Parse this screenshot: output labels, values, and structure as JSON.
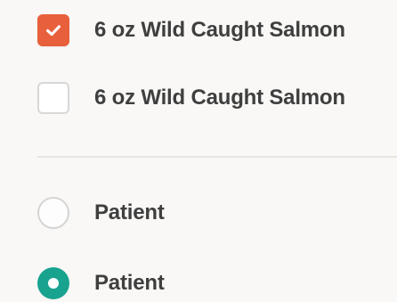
{
  "checkbox_list": {
    "items": [
      {
        "label": "6 oz Wild Caught Salmon",
        "checked": true
      },
      {
        "label": "6 oz Wild Caught Salmon",
        "checked": false
      }
    ]
  },
  "radio_list": {
    "items": [
      {
        "label": "Patient",
        "selected": false
      },
      {
        "label": "Patient",
        "selected": true
      }
    ]
  },
  "icons": {
    "checked_checkbox": "checkmark-icon",
    "selected_radio": "radio-selected-icon"
  },
  "colors": {
    "checkbox_checked_fill": "#e85f3c",
    "radio_selected_fill": "#18a38f",
    "checkbox_unchecked_border": "#d7d7d7",
    "radio_unchecked_border": "#d4d4d4"
  }
}
